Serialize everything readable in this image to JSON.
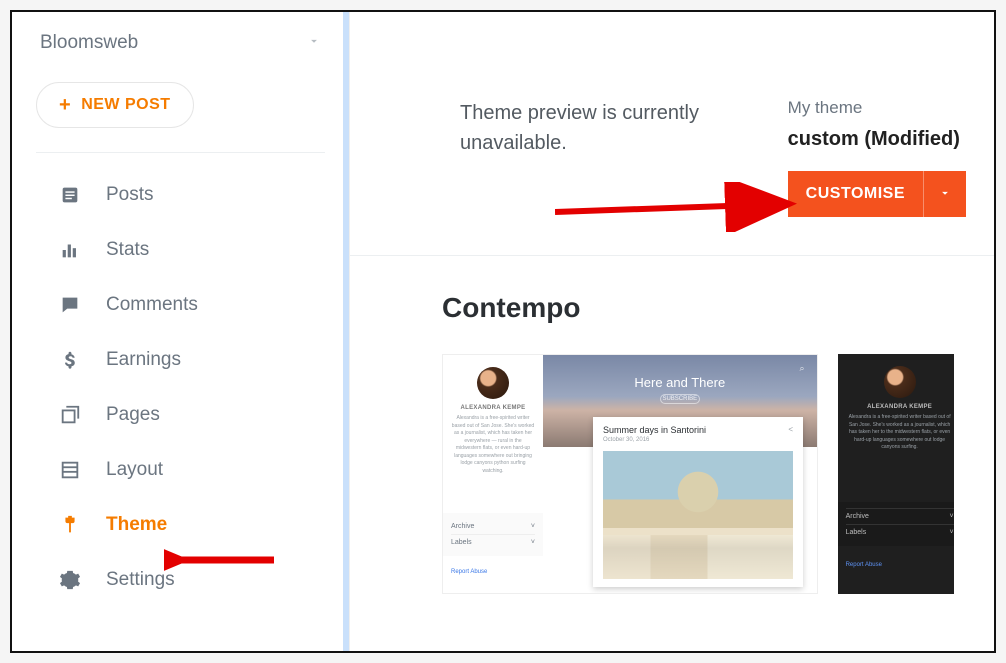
{
  "blog": {
    "name": "Bloomsweb"
  },
  "new_post_label": "NEW POST",
  "nav": {
    "items": [
      {
        "label": "Posts"
      },
      {
        "label": "Stats"
      },
      {
        "label": "Comments"
      },
      {
        "label": "Earnings"
      },
      {
        "label": "Pages"
      },
      {
        "label": "Layout"
      },
      {
        "label": "Theme"
      },
      {
        "label": "Settings"
      }
    ],
    "active_index": 6
  },
  "theme_header": {
    "preview_line1": "Theme preview is currently",
    "preview_line2": "unavailable.",
    "my_theme_label": "My theme",
    "current_theme": "custom (Modified)",
    "customise_label": "CUSTOMISE"
  },
  "theme_groups": [
    {
      "title": "Contempo",
      "variants": [
        {
          "profile_name": "ALEXANDRA KEMPE",
          "hero_title": "Here and There",
          "hero_sub": "SUBSCRIBE",
          "post_title": "Summer days in Santorini",
          "post_date": "October 30, 2016",
          "widgets": {
            "archive": "Archive",
            "labels": "Labels"
          },
          "report_link": "Report Abuse"
        },
        {
          "profile_name": "ALEXANDRA KEMPE",
          "widgets": {
            "archive": "Archive",
            "labels": "Labels"
          },
          "report_link": "Report Abuse"
        }
      ]
    }
  ]
}
